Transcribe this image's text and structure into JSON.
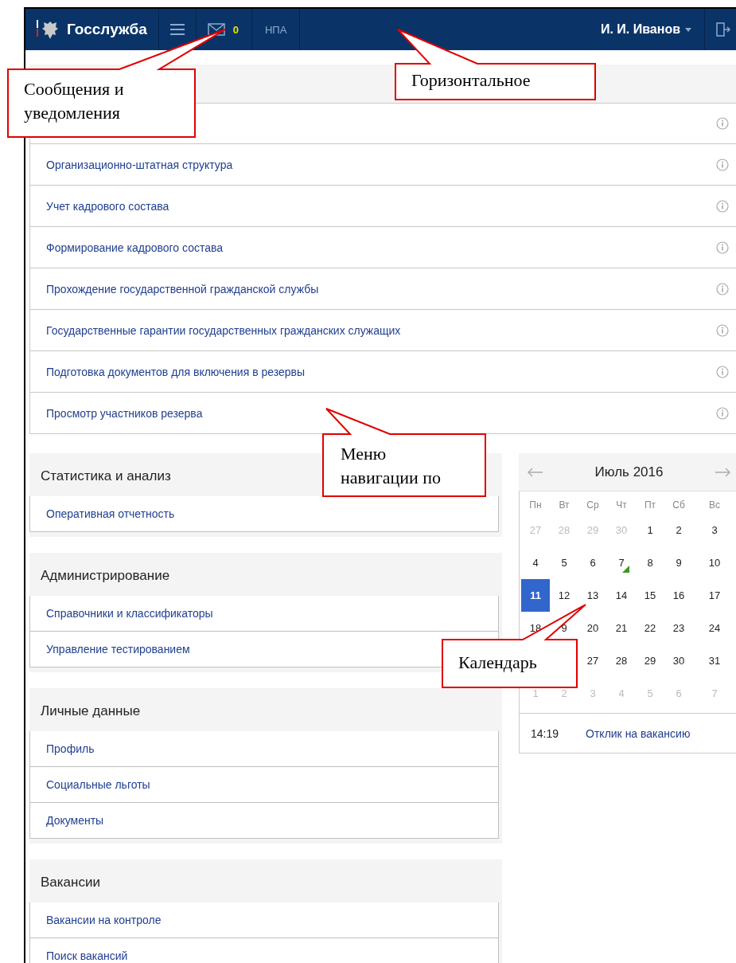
{
  "header": {
    "brand": "Госслужба",
    "messages_count": "0",
    "links": [
      {
        "label": "НПА"
      }
    ],
    "user": "И. И. Иванов"
  },
  "nav_list": {
    "rows": [
      {},
      {
        "label": "Организационно-штатная структура"
      },
      {
        "label": "Учет кадрового состава"
      },
      {
        "label": "Формирование кадрового состава"
      },
      {
        "label": "Прохождение государственной гражданской службы"
      },
      {
        "label": "Государственные гарантии государственных гражданских служащих"
      },
      {
        "label": "Подготовка документов для включения в резервы"
      },
      {
        "label": "Просмотр участников резерва"
      }
    ]
  },
  "sections": [
    {
      "title": "Статистика и анализ",
      "items": [
        "Оперативная отчетность"
      ]
    },
    {
      "title": "Администрирование",
      "items": [
        "Справочники и классификаторы",
        "Управление тестированием"
      ]
    },
    {
      "title": "Личные данные",
      "items": [
        "Профиль",
        "Социальные льготы",
        "Документы"
      ]
    },
    {
      "title": "Вакансии",
      "items": [
        "Вакансии на контроле",
        "Поиск вакансий"
      ]
    }
  ],
  "calendar": {
    "title": "Июль 2016",
    "weekdays": [
      "Пн",
      "Вт",
      "Ср",
      "Чт",
      "Пт",
      "Сб",
      "Вс"
    ],
    "weeks": [
      [
        {
          "day": "27",
          "muted": true,
          "selected": false,
          "event": false
        },
        {
          "day": "28",
          "muted": true,
          "selected": false,
          "event": false
        },
        {
          "day": "29",
          "muted": true,
          "selected": false,
          "event": false
        },
        {
          "day": "30",
          "muted": true,
          "selected": false,
          "event": false
        },
        {
          "day": "1",
          "muted": false,
          "selected": false,
          "event": false
        },
        {
          "day": "2",
          "muted": false,
          "selected": false,
          "event": false
        },
        {
          "day": "3",
          "muted": false,
          "selected": false,
          "event": false
        }
      ],
      [
        {
          "day": "4",
          "muted": false,
          "selected": false,
          "event": false
        },
        {
          "day": "5",
          "muted": false,
          "selected": false,
          "event": false
        },
        {
          "day": "6",
          "muted": false,
          "selected": false,
          "event": false
        },
        {
          "day": "7",
          "muted": false,
          "selected": false,
          "event": true
        },
        {
          "day": "8",
          "muted": false,
          "selected": false,
          "event": false
        },
        {
          "day": "9",
          "muted": false,
          "selected": false,
          "event": false
        },
        {
          "day": "10",
          "muted": false,
          "selected": false,
          "event": false
        }
      ],
      [
        {
          "day": "11",
          "muted": false,
          "selected": true,
          "event": false
        },
        {
          "day": "12",
          "muted": false,
          "selected": false,
          "event": false
        },
        {
          "day": "13",
          "muted": false,
          "selected": false,
          "event": false
        },
        {
          "day": "14",
          "muted": false,
          "selected": false,
          "event": false
        },
        {
          "day": "15",
          "muted": false,
          "selected": false,
          "event": false
        },
        {
          "day": "16",
          "muted": false,
          "selected": false,
          "event": false
        },
        {
          "day": "17",
          "muted": false,
          "selected": false,
          "event": false
        }
      ],
      [
        {
          "day": "18",
          "muted": false,
          "selected": false,
          "event": false
        },
        {
          "day": "9",
          "muted": false,
          "selected": false,
          "event": false
        },
        {
          "day": "20",
          "muted": false,
          "selected": false,
          "event": false
        },
        {
          "day": "21",
          "muted": false,
          "selected": false,
          "event": false
        },
        {
          "day": "22",
          "muted": false,
          "selected": false,
          "event": false
        },
        {
          "day": "23",
          "muted": false,
          "selected": false,
          "event": false
        },
        {
          "day": "24",
          "muted": false,
          "selected": false,
          "event": false
        }
      ],
      [
        {
          "day": "27",
          "muted": false,
          "selected": false,
          "event": false
        },
        {
          "day": "28",
          "muted": false,
          "selected": false,
          "event": false
        },
        {
          "day": "29",
          "muted": false,
          "selected": false,
          "event": false
        },
        {
          "day": "30",
          "muted": false,
          "selected": false,
          "event": false
        },
        {
          "day": "31",
          "muted": false,
          "selected": false,
          "event": false
        }
      ],
      [
        {
          "day": "1",
          "muted": true,
          "selected": false,
          "event": false
        },
        {
          "day": "2",
          "muted": true,
          "selected": false,
          "event": false
        },
        {
          "day": "3",
          "muted": true,
          "selected": false,
          "event": false
        },
        {
          "day": "4",
          "muted": true,
          "selected": false,
          "event": false
        },
        {
          "day": "5",
          "muted": true,
          "selected": false,
          "event": false
        },
        {
          "day": "6",
          "muted": true,
          "selected": false,
          "event": false
        },
        {
          "day": "7",
          "muted": true,
          "selected": false,
          "event": false
        }
      ]
    ],
    "events": [
      {
        "time": "14:19",
        "title": "Отклик на вакансию"
      }
    ]
  },
  "callouts": [
    {
      "text": "Сообщения и\nуведомления"
    },
    {
      "text": "Горизонтальное"
    },
    {
      "text": "Меню\nнавигации по"
    },
    {
      "text": "Календарь"
    }
  ]
}
